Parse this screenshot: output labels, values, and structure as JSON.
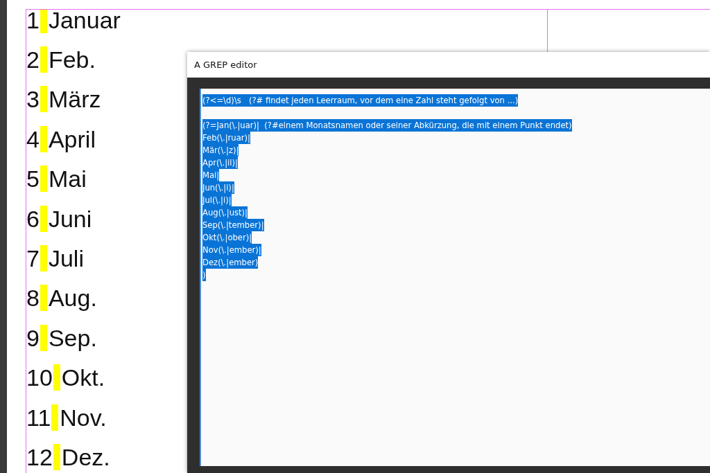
{
  "months": [
    {
      "number": "1",
      "name": "Januar",
      "highlighted": true
    },
    {
      "number": "2",
      "name": "Feb.",
      "highlighted": true
    },
    {
      "number": "3",
      "name": "März",
      "highlighted": true
    },
    {
      "number": "4",
      "name": "April",
      "highlighted": true
    },
    {
      "number": "5",
      "name": "Mai",
      "highlighted": true
    },
    {
      "number": "6",
      "name": "Juni",
      "highlighted": true
    },
    {
      "number": "7",
      "name": "Juli",
      "highlighted": true
    },
    {
      "number": "8",
      "name": "Aug.",
      "highlighted": true
    },
    {
      "number": "9",
      "name": "Sep.",
      "highlighted": true
    },
    {
      "number": "10",
      "name": "Okt.",
      "highlighted": true
    },
    {
      "number": "11",
      "name": "Nov.",
      "highlighted": true
    },
    {
      "number": "12",
      "name": "Dez.",
      "highlighted": true
    }
  ],
  "window": {
    "title": "A GREP editor"
  },
  "editor": {
    "selected": true,
    "blocks": [
      [
        "(?<=\\d)\\s   (?# findet jeden Leerraum, vor dem eine Zahl steht gefolgt von ...)"
      ],
      [
        "(?=Jan(\\.|uar)|  (?#einem Monatsnamen oder seiner Abkürzung, die mit einem Punkt endet)",
        "Feb(\\.|ruar)|",
        "Mär(\\.|z)|",
        "Apr(\\.|il)|",
        "Mai|",
        "Jun(\\.|i)|",
        "Jul(\\.|i)|",
        "Aug(\\.|ust)|",
        "Sep(\\.|tember)|",
        "Okt(\\.|ober)|",
        "Nov(\\.|ember)|",
        "Dez(\\.|ember)",
        ")"
      ]
    ]
  }
}
